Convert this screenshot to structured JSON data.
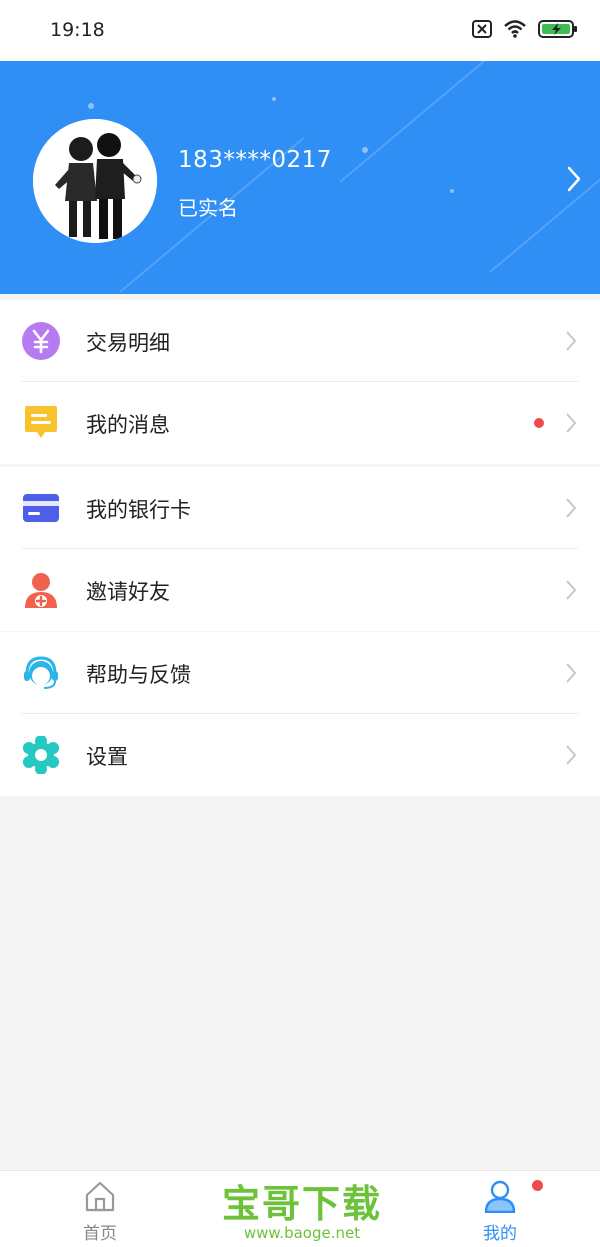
{
  "status_bar": {
    "time": "19:18"
  },
  "profile": {
    "phone": "183****0217",
    "status": "已实名"
  },
  "menu_groups": [
    [
      {
        "label": "交易明细",
        "icon": "yen-icon",
        "badge": false
      },
      {
        "label": "我的消息",
        "icon": "message-icon",
        "badge": true
      }
    ],
    [
      {
        "label": "我的银行卡",
        "icon": "bank-card-icon",
        "badge": false
      },
      {
        "label": "邀请好友",
        "icon": "invite-friend-icon",
        "badge": false
      }
    ],
    [
      {
        "label": "帮助与反馈",
        "icon": "headset-icon",
        "badge": false
      },
      {
        "label": "设置",
        "icon": "settings-icon",
        "badge": false
      }
    ]
  ],
  "tabbar": {
    "home_label": "首页",
    "mine_label": "我的"
  },
  "watermark": {
    "title": "宝哥下载",
    "url": "www.baoge.net"
  },
  "colors": {
    "brand_blue": "#2f8ff5",
    "badge_red": "#f04a4a",
    "watermark_green": "#6cc33a"
  }
}
